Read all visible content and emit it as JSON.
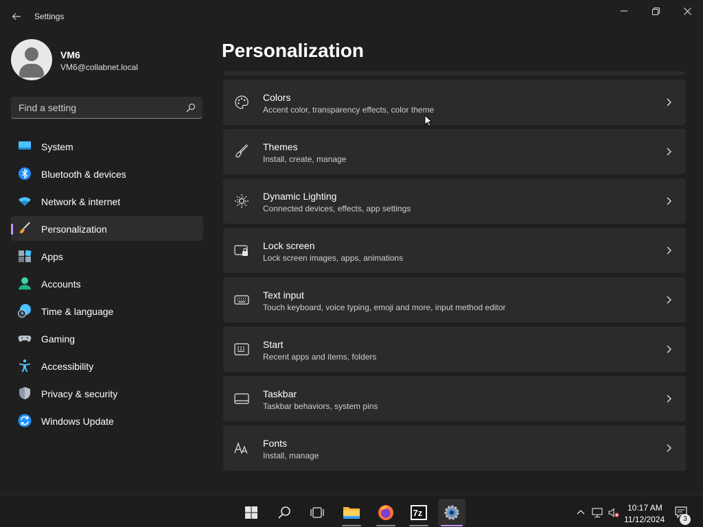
{
  "window": {
    "app_title": "Settings",
    "controls": {
      "minimize": "minimize-icon",
      "maximize": "restore-icon",
      "close": "close-icon"
    }
  },
  "profile": {
    "name": "VM6",
    "email": "VM6@collabnet.local"
  },
  "search": {
    "placeholder": "Find a setting"
  },
  "sidebar": {
    "items": [
      {
        "label": "System",
        "icon": "monitor-icon",
        "active": false
      },
      {
        "label": "Bluetooth & devices",
        "icon": "bluetooth-icon",
        "active": false
      },
      {
        "label": "Network & internet",
        "icon": "wifi-icon",
        "active": false
      },
      {
        "label": "Personalization",
        "icon": "brush-icon",
        "active": true
      },
      {
        "label": "Apps",
        "icon": "apps-icon",
        "active": false
      },
      {
        "label": "Accounts",
        "icon": "person-icon",
        "active": false
      },
      {
        "label": "Time & language",
        "icon": "globe-clock-icon",
        "active": false
      },
      {
        "label": "Gaming",
        "icon": "gamepad-icon",
        "active": false
      },
      {
        "label": "Accessibility",
        "icon": "accessibility-icon",
        "active": false
      },
      {
        "label": "Privacy & security",
        "icon": "shield-icon",
        "active": false
      },
      {
        "label": "Windows Update",
        "icon": "update-icon",
        "active": false
      }
    ]
  },
  "main": {
    "title": "Personalization",
    "cards": [
      {
        "title": "Colors",
        "subtitle": "Accent color, transparency effects, color theme",
        "icon": "palette-icon"
      },
      {
        "title": "Themes",
        "subtitle": "Install, create, manage",
        "icon": "brush-icon"
      },
      {
        "title": "Dynamic Lighting",
        "subtitle": "Connected devices, effects, app settings",
        "icon": "lighting-icon"
      },
      {
        "title": "Lock screen",
        "subtitle": "Lock screen images, apps, animations",
        "icon": "lock-screen-icon"
      },
      {
        "title": "Text input",
        "subtitle": "Touch keyboard, voice typing, emoji and more, input method editor",
        "icon": "keyboard-icon"
      },
      {
        "title": "Start",
        "subtitle": "Recent apps and items, folders",
        "icon": "start-icon"
      },
      {
        "title": "Taskbar",
        "subtitle": "Taskbar behaviors, system pins",
        "icon": "taskbar-icon"
      },
      {
        "title": "Fonts",
        "subtitle": "Install, manage",
        "icon": "fonts-icon"
      }
    ]
  },
  "taskbar": {
    "apps": [
      "windows-start-icon",
      "search-icon",
      "task-view-icon",
      "file-explorer-icon",
      "firefox-icon",
      "7zip-icon",
      "settings-icon"
    ],
    "clock": {
      "time": "10:17 AM",
      "date": "11/12/2024"
    },
    "notifications": {
      "count": "3"
    }
  },
  "colors": {
    "accent": "#c896ff",
    "background": "#1f1f1f",
    "card": "#2b2b2b"
  }
}
